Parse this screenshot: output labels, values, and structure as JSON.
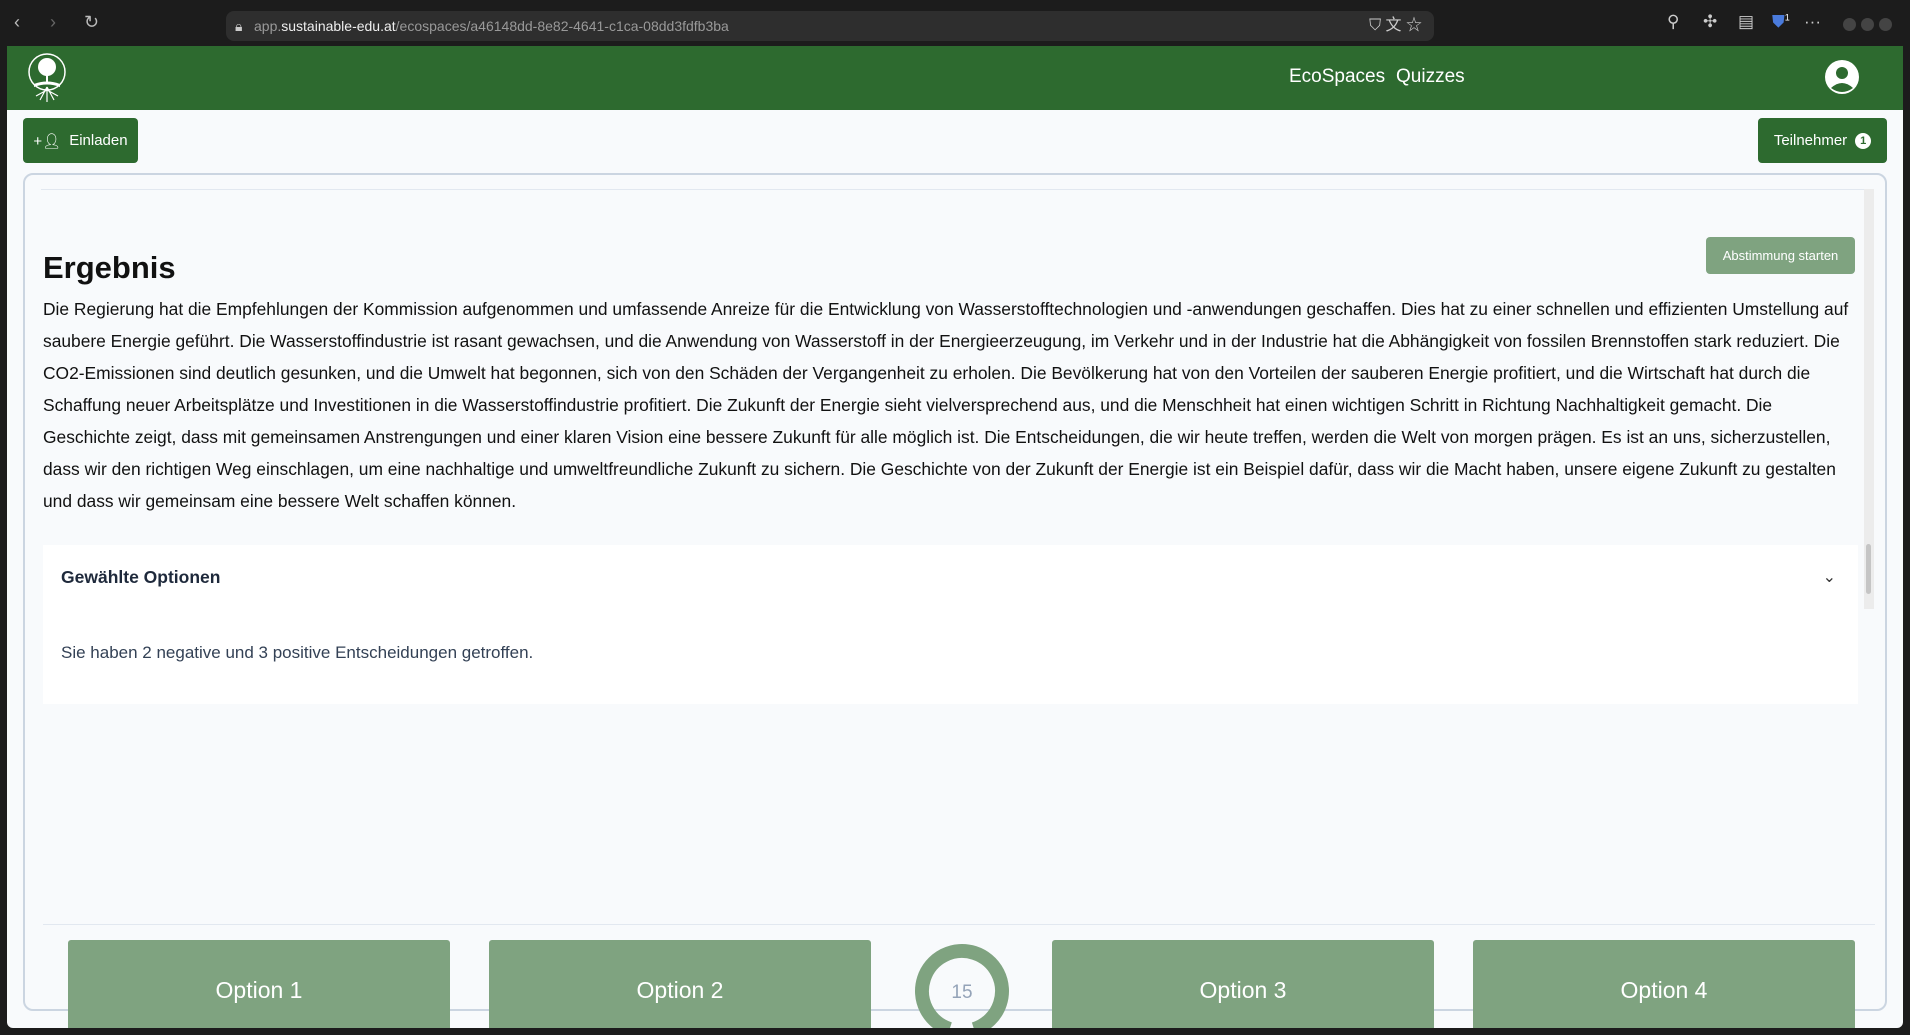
{
  "browser": {
    "url_prefix": "app.",
    "url_host": "sustainable-edu.at",
    "url_path": "/ecospaces/a46148dd-8e82-4641-c1ca-08dd3fdfb3ba",
    "ext_badge": "1"
  },
  "header": {
    "nav": [
      "EcoSpaces",
      "Quizzes"
    ]
  },
  "toolbar": {
    "invite": "Einladen",
    "participants": "Teilnehmer",
    "participants_count": "1"
  },
  "main": {
    "vote_button": "Abstimmung starten",
    "title": "Ergebnis",
    "text": "Die Regierung hat die Empfehlungen der Kommission aufgenommen und umfassende Anreize für die Entwicklung von Wasserstofftechnologien und -anwendungen geschaffen. Dies hat zu einer schnellen und effizienten Umstellung auf saubere Energie geführt. Die Wasserstoffindustrie ist rasant gewachsen, und die Anwendung von Wasserstoff in der Energieerzeugung, im Verkehr und in der Industrie hat die Abhängigkeit von fossilen Brennstoffen stark reduziert. Die CO2-Emissionen sind deutlich gesunken, und die Umwelt hat begonnen, sich von den Schäden der Vergangenheit zu erholen. Die Bevölkerung hat von den Vorteilen der sauberen Energie profitiert, und die Wirtschaft hat durch die Schaffung neuer Arbeitsplätze und Investitionen in die Wasserstoffindustrie profitiert. Die Zukunft der Energie sieht vielversprechend aus, und die Menschheit hat einen wichtigen Schritt in Richtung Nachhaltigkeit gemacht. Die Geschichte zeigt, dass mit gemeinsamen Anstrengungen und einer klaren Vision eine bessere Zukunft für alle möglich ist. Die Entscheidungen, die wir heute treffen, werden die Welt von morgen prägen. Es ist an uns, sicherzustellen, dass wir den richtigen Weg einschlagen, um eine nachhaltige und umweltfreundliche Zukunft zu sichern. Die Geschichte von der Zukunft der Energie ist ein Beispiel dafür, dass wir die Macht haben, unsere eigene Zukunft zu gestalten und dass wir gemeinsam eine bessere Welt schaffen können.",
    "accordion_title": "Gewählte Optionen",
    "accordion_body": "Sie haben 2 negative und 3 positive Entscheidungen getroffen."
  },
  "options": [
    "Option 1",
    "Option 2",
    "Option 3",
    "Option 4"
  ],
  "timer": {
    "value": "15",
    "progress": 0.9
  },
  "colors": {
    "brand": "#2d6a2f",
    "option": "#7fa380"
  }
}
